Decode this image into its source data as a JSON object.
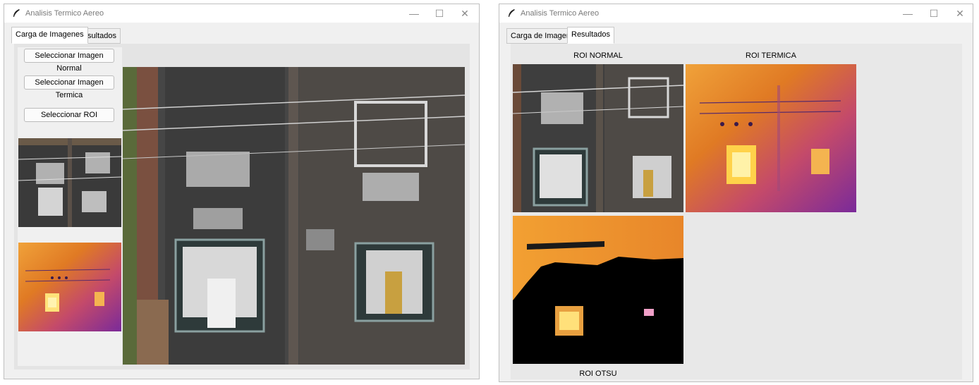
{
  "window_left": {
    "title": "Analisis Termico Aereo",
    "tabs": [
      "Carga de Imagenes",
      "Resultados"
    ],
    "active_tab": "Carga de Imagenes",
    "buttons": {
      "normal": "Seleccionar Imagen Normal",
      "thermal": "Seleccionar Imagen Termica",
      "roi": "Seleccionar ROI"
    }
  },
  "window_right": {
    "title": "Analisis Termico Aereo",
    "tabs": [
      "Carga de Imagenes",
      "Resultados"
    ],
    "active_tab": "Resultados",
    "labels": {
      "roi_normal": "ROI NORMAL",
      "roi_termica": "ROI TERMICA",
      "roi_otsu": "ROI OTSU"
    }
  },
  "window_controls": {
    "minimize": "—",
    "maximize": "☐",
    "close": "✕"
  },
  "icons": [
    "feather-icon",
    "minimize-icon",
    "maximize-icon",
    "close-icon"
  ],
  "colors": {
    "thermal_hot": "#ffd24a",
    "thermal_mid": "#e0701e",
    "thermal_cool": "#8a2a9a",
    "otsu_bg": "#000000"
  }
}
